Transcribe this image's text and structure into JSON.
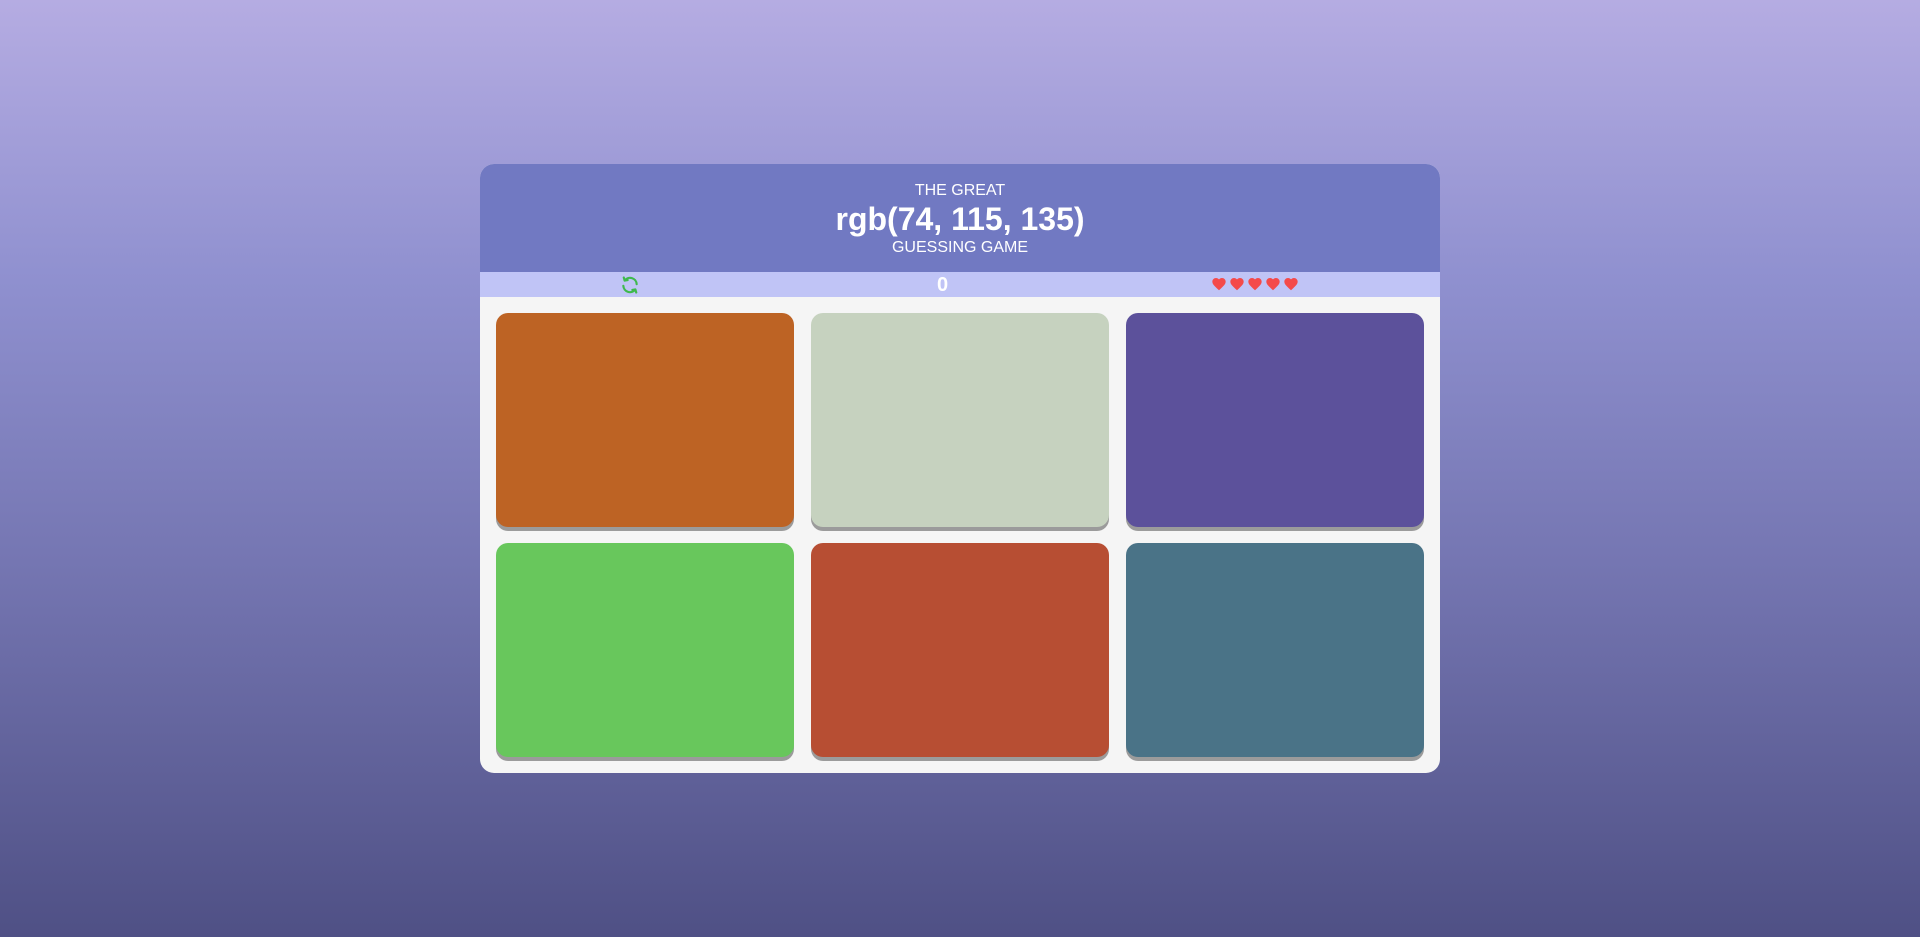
{
  "header": {
    "title_top": "THE GREAT",
    "target_color": "rgb(74, 115, 135)",
    "title_bottom": "GUESSING GAME"
  },
  "toolbar": {
    "refresh_icon": "refresh-icon",
    "score": "0",
    "lives_icon": "heart-icon",
    "lives_count": 5
  },
  "colors": {
    "header_bg": "#7179c2",
    "toolbar_bg": "#c0c4f6",
    "refresh_icon_color": "#3fb94d",
    "heart_color": "#f44a4a"
  },
  "tiles": [
    {
      "color": "#bd6324"
    },
    {
      "color": "#c6d2bf"
    },
    {
      "color": "#5c519b"
    },
    {
      "color": "#68c75c"
    },
    {
      "color": "#b74e33"
    },
    {
      "color": "#4a7387"
    }
  ]
}
